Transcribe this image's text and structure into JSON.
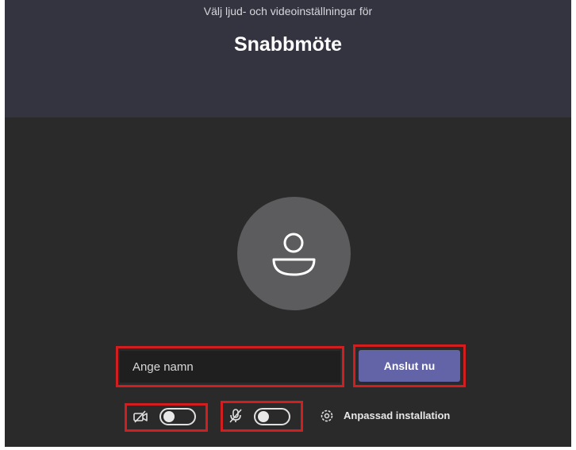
{
  "header": {
    "subtitle": "Välj ljud- och videoinställningar för",
    "title": "Snabbmöte"
  },
  "avatar": {
    "icon": "person-icon"
  },
  "name_field": {
    "placeholder": "Ange namn",
    "value": ""
  },
  "join_button": {
    "label": "Anslut nu"
  },
  "controls": {
    "camera": {
      "icon": "camera-off-icon",
      "enabled": false
    },
    "microphone": {
      "icon": "microphone-off-icon",
      "enabled": false
    },
    "device_settings": {
      "icon": "gear-icon",
      "label": "Anpassad installation"
    }
  },
  "colors": {
    "header_bg": "#33343f",
    "body_bg": "#2a2a2a",
    "accent": "#6264a7",
    "highlight": "#d21e1e"
  }
}
